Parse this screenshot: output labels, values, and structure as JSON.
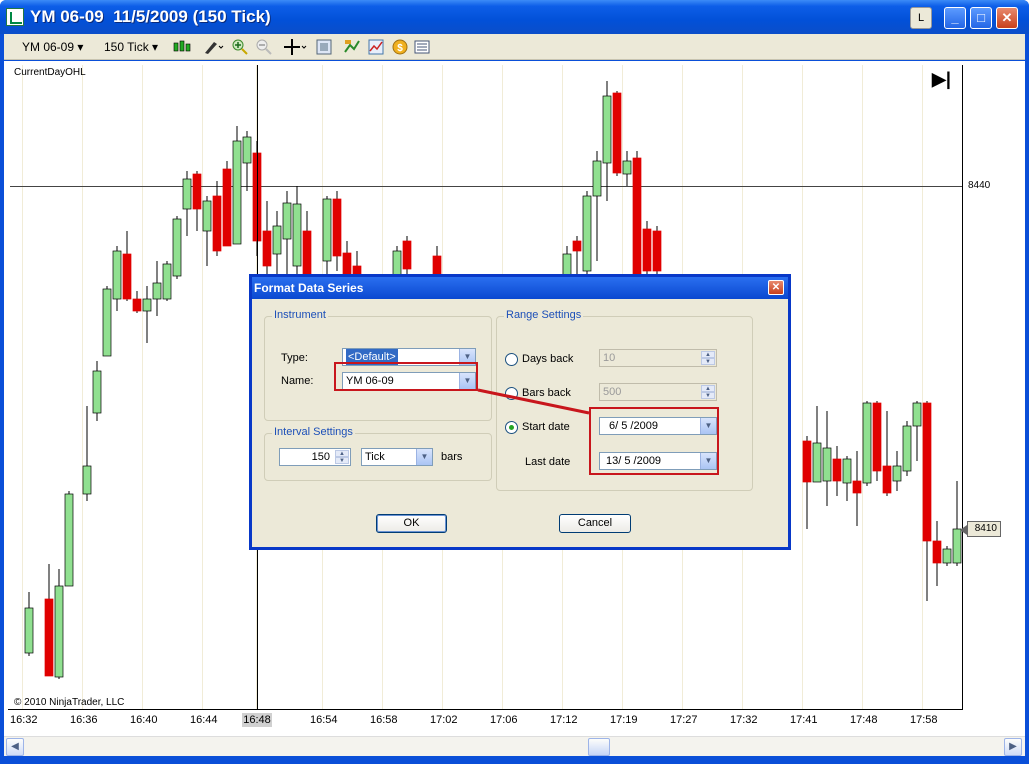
{
  "window": {
    "title": "YM 06-09  11/5/2009 (150 Tick)",
    "btn_L": "L",
    "btn_min": "_",
    "btn_max": "□",
    "btn_close": "✕"
  },
  "toolbar": {
    "instrument": "YM 06-09",
    "interval": "150 Tick",
    "icons": [
      "bar-type-icon",
      "draw-tools-icon",
      "zoom-in-icon",
      "zoom-out-icon",
      "crosshair-icon",
      "properties-icon",
      "data-series-icon",
      "indicators-icon",
      "strategies-icon",
      "data-box-icon"
    ]
  },
  "chart": {
    "indicator_label": "CurrentDayOHL",
    "copyright": "© 2010 NinjaTrader, LLC",
    "price_line": "8440",
    "last_price": "8410",
    "cursor_time": "16:48",
    "x_ticks": [
      "16:32",
      "16:36",
      "16:40",
      "16:44",
      "16:48",
      "16:54",
      "16:58",
      "17:02",
      "17:06",
      "17:12",
      "17:19",
      "17:27",
      "17:32",
      "17:41",
      "17:48",
      "17:58"
    ],
    "colors": {
      "up": "#90e090",
      "down": "#e00000",
      "grid": "#f1ecd7"
    }
  },
  "dialog": {
    "title": "Format Data Series",
    "close": "✕",
    "instrument_group": "Instrument",
    "type_label": "Type:",
    "type_value": "<Default>",
    "name_label": "Name:",
    "name_value": "YM 06-09",
    "interval_group": "Interval Settings",
    "interval_value": "150",
    "interval_type": "Tick",
    "bars_label": "bars",
    "range_group": "Range Settings",
    "days_back_label": "Days back",
    "days_back_value": "10",
    "bars_back_label": "Bars back",
    "bars_back_value": "500",
    "start_date_label": "Start date",
    "start_date_value": "6/ 5 /2009",
    "last_date_label": "Last date",
    "last_date_value": "13/ 5 /2009",
    "ok": "OK",
    "cancel": "Cancel"
  }
}
